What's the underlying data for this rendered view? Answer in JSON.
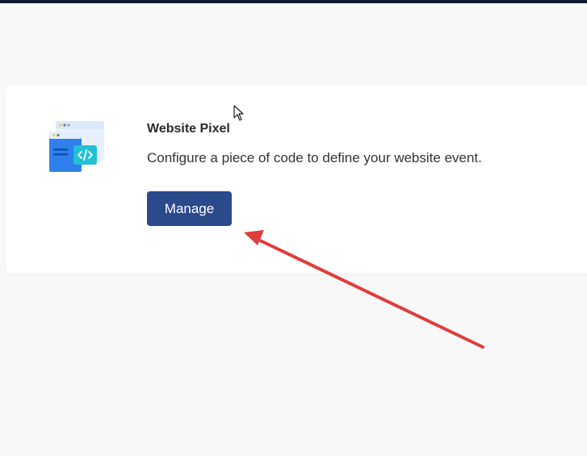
{
  "card": {
    "title": "Website Pixel",
    "description": "Configure a piece of code to define your website event.",
    "manage_label": "Manage",
    "icon": "website-pixel-code-icon"
  },
  "colors": {
    "top_bar": "#0f1a33",
    "page_background": "#f8f8f8",
    "card_background": "#ffffff",
    "button_background": "#2a4a8b",
    "button_text": "#ffffff",
    "annotation_arrow": "#e03c3c",
    "code_badge": "#22c1d6",
    "window_blue": "#2f80ed"
  },
  "annotation": {
    "type": "arrow",
    "points_to": "manage-button"
  },
  "cursor": {
    "icon": "arrow-cursor-icon"
  }
}
